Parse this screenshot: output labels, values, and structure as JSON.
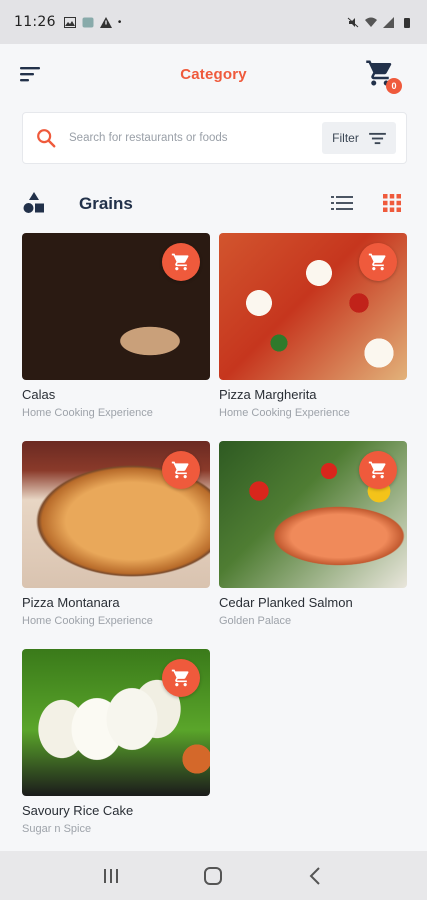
{
  "status_bar": {
    "time": "11:26"
  },
  "header": {
    "title": "Category",
    "cart_count": "0"
  },
  "search": {
    "placeholder": "Search for restaurants or foods",
    "filter_label": "Filter"
  },
  "category": {
    "name": "Grains"
  },
  "colors": {
    "accent": "#ef5a3c",
    "title_dark": "#22314a"
  },
  "items": [
    {
      "name": "Calas",
      "subtitle": "Home Cooking Experience"
    },
    {
      "name": "Pizza Margherita",
      "subtitle": "Home Cooking Experience"
    },
    {
      "name": "Pizza Montanara",
      "subtitle": "Home Cooking Experience"
    },
    {
      "name": "Cedar Planked Salmon",
      "subtitle": "Golden Palace"
    },
    {
      "name": "Savoury Rice Cake",
      "subtitle": "Sugar n Spice"
    }
  ]
}
